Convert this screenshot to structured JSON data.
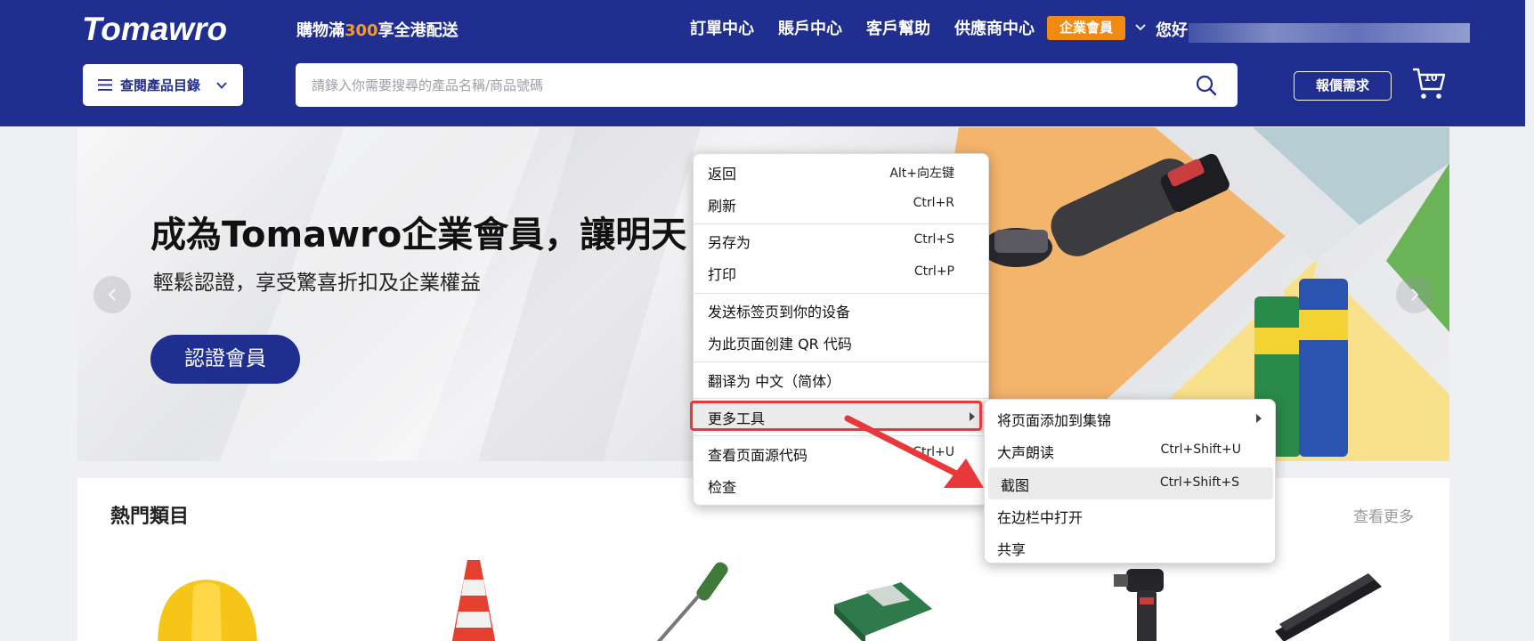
{
  "header": {
    "logo_text": "Tomawro",
    "promo_prefix": "購物滿",
    "promo_amount": "300",
    "promo_suffix": "享全港配送",
    "nav": [
      "訂單中心",
      "賬戶中心",
      "客戶幫助",
      "供應商中心"
    ],
    "vip_badge": "企業會員",
    "greeting": "您好",
    "catalog_label": "查閱產品目錄",
    "search_placeholder": "請錄入你需要搜尋的產品名稱/商品號碼",
    "quote_label": "報價需求",
    "cart_count": "10",
    "colors": {
      "brand": "#1f2e8f",
      "accent": "#f08a12"
    }
  },
  "banner": {
    "title": "成為Tomawro企業會員，讓明天",
    "subtitle": "輕鬆認證，享受驚喜折扣及企業權益",
    "cta": "認證會員"
  },
  "hot_categories": {
    "title": "熱門類目",
    "see_more": "查看更多",
    "items": [
      "hard-hat-icon",
      "traffic-cone-icon",
      "screwdriver-icon",
      "tarp-icon",
      "impact-drill-icon",
      "stapler-icon"
    ]
  },
  "context_menu": {
    "items": [
      {
        "label": "返回",
        "shortcut": "Alt+向左键"
      },
      {
        "label": "刷新",
        "shortcut": "Ctrl+R"
      },
      {
        "label": "另存为",
        "shortcut": "Ctrl+S"
      },
      {
        "label": "打印",
        "shortcut": "Ctrl+P"
      },
      {
        "label": "发送标签页到你的设备",
        "shortcut": ""
      },
      {
        "label": "为此页面创建 QR 代码",
        "shortcut": ""
      },
      {
        "label": "翻译为 中文（简体）",
        "shortcut": ""
      },
      {
        "label": "更多工具",
        "shortcut": ""
      },
      {
        "label": "查看页面源代码",
        "shortcut": "Ctrl+U"
      },
      {
        "label": "检查",
        "shortcut": ""
      }
    ]
  },
  "submenu": {
    "items": [
      {
        "label": "将页面添加到集锦",
        "shortcut": ""
      },
      {
        "label": "大声朗读",
        "shortcut": "Ctrl+Shift+U"
      },
      {
        "label": "截图",
        "shortcut": "Ctrl+Shift+S"
      },
      {
        "label": "在边栏中打开",
        "shortcut": ""
      },
      {
        "label": "共享",
        "shortcut": ""
      }
    ]
  }
}
